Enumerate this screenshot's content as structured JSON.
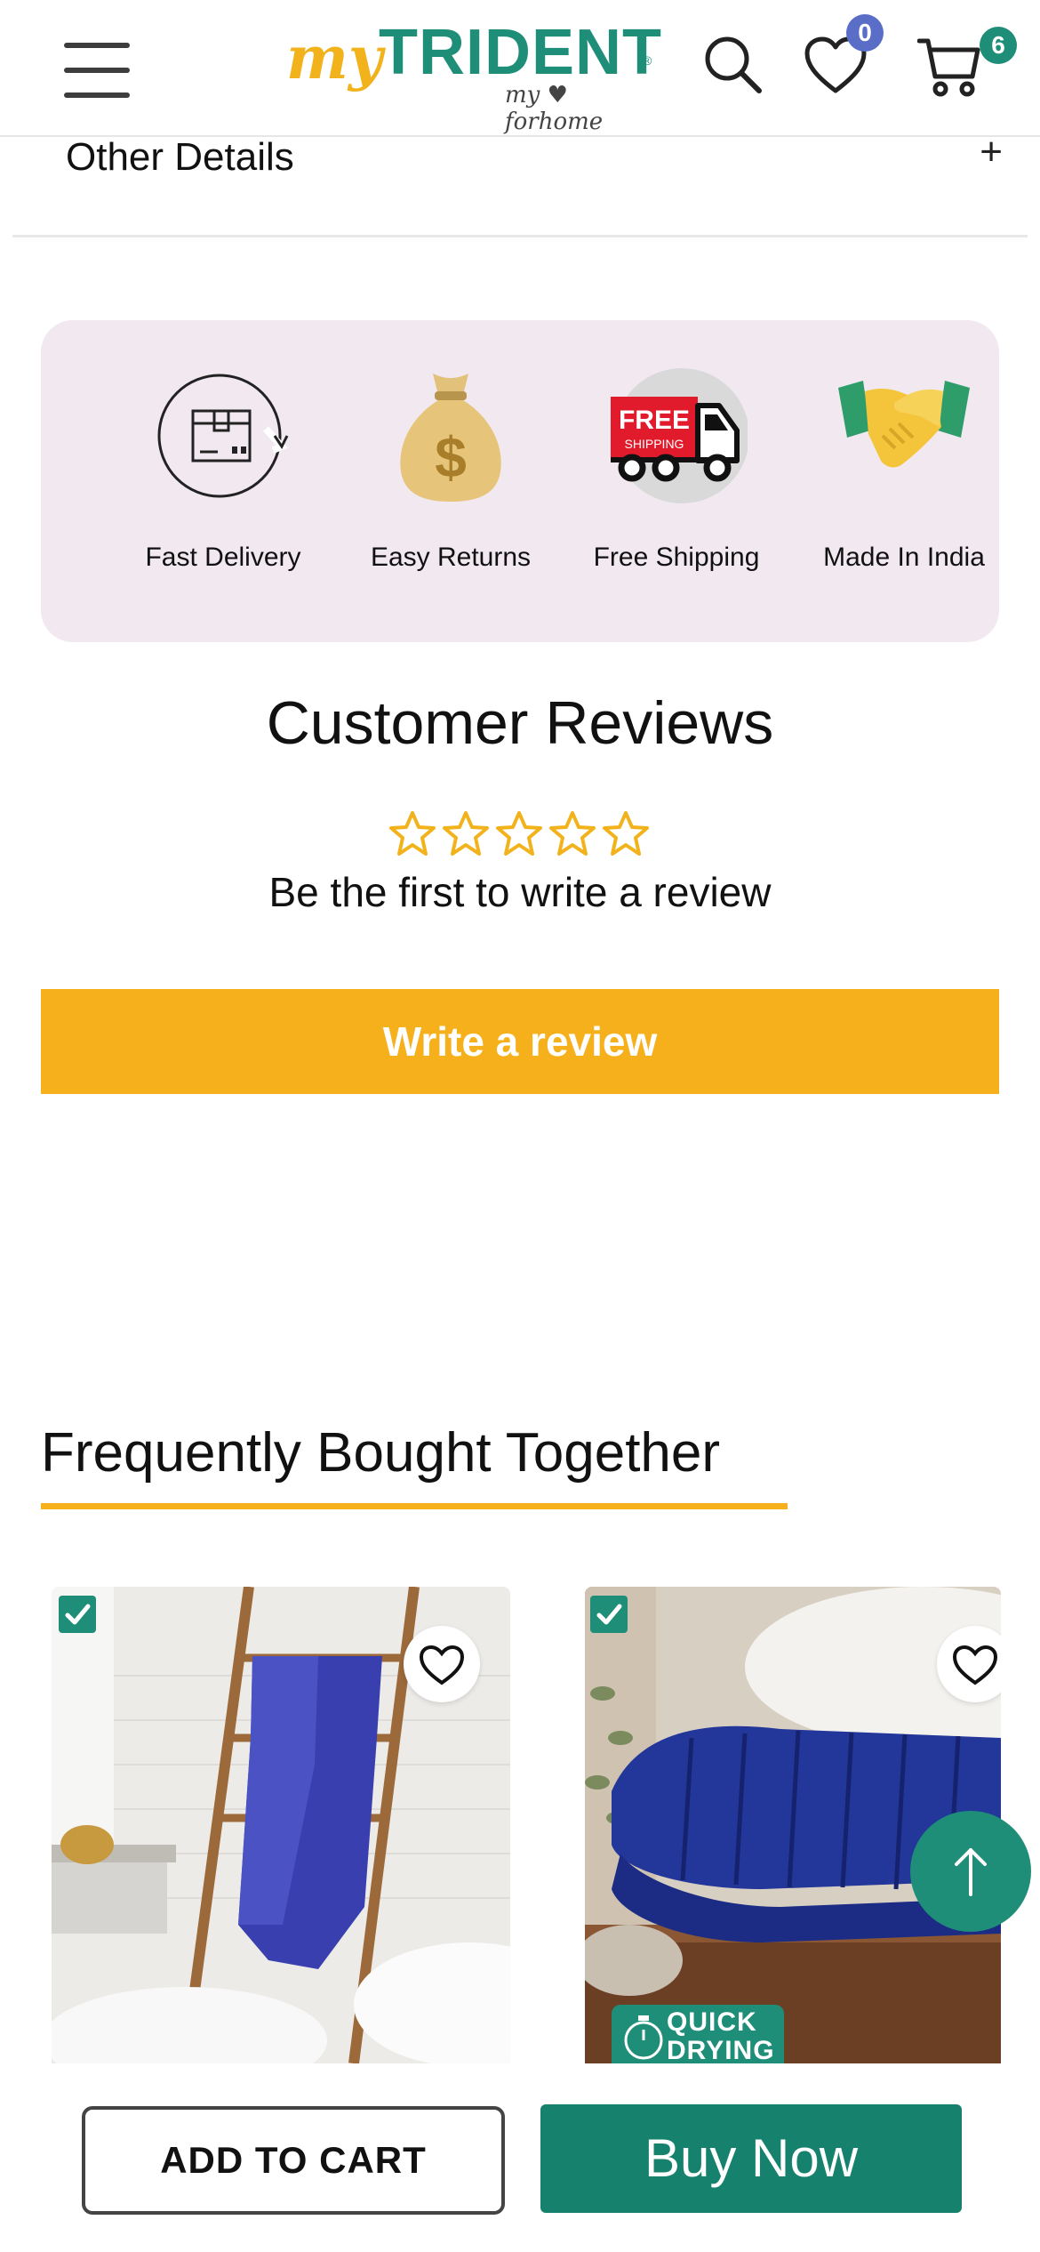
{
  "header": {
    "logo_my": "my",
    "logo_brand": "TRIDENT",
    "logo_tagline": "my ♥ forhome",
    "wishlist_count": "0",
    "cart_count": "6",
    "colors": {
      "brand_green": "#1f8e78",
      "brand_yellow": "#f2b21c",
      "wishlist_badge": "#5b6ec7"
    }
  },
  "other_details": {
    "label": "Other Details",
    "toggle": "+"
  },
  "features": [
    {
      "label": "Fast Delivery",
      "icon": "delivery-box-icon"
    },
    {
      "label": "Easy Returns",
      "icon": "money-bag-icon"
    },
    {
      "label": "Free Shipping",
      "icon": "free-shipping-truck-icon",
      "badge_text_1": "FREE",
      "badge_text_2": "SHIPPING"
    },
    {
      "label": "Made In India",
      "icon": "handshake-icon"
    }
  ],
  "reviews": {
    "title": "Customer Reviews",
    "rating_stars_filled": 0,
    "rating_stars_total": 5,
    "subtitle": "Be the first to write a review",
    "write_button": "Write a review"
  },
  "fbt": {
    "title": "Frequently Bought Together",
    "products": [
      {
        "checked": true,
        "image": "blue-towel-on-ladder",
        "wishlisted": false
      },
      {
        "checked": true,
        "image": "folded-blue-towel-on-bench",
        "wishlisted": false,
        "badge": "QUICK DRYING"
      }
    ]
  },
  "actions": {
    "add_to_cart": "ADD TO CART",
    "buy_now": "Buy Now"
  }
}
